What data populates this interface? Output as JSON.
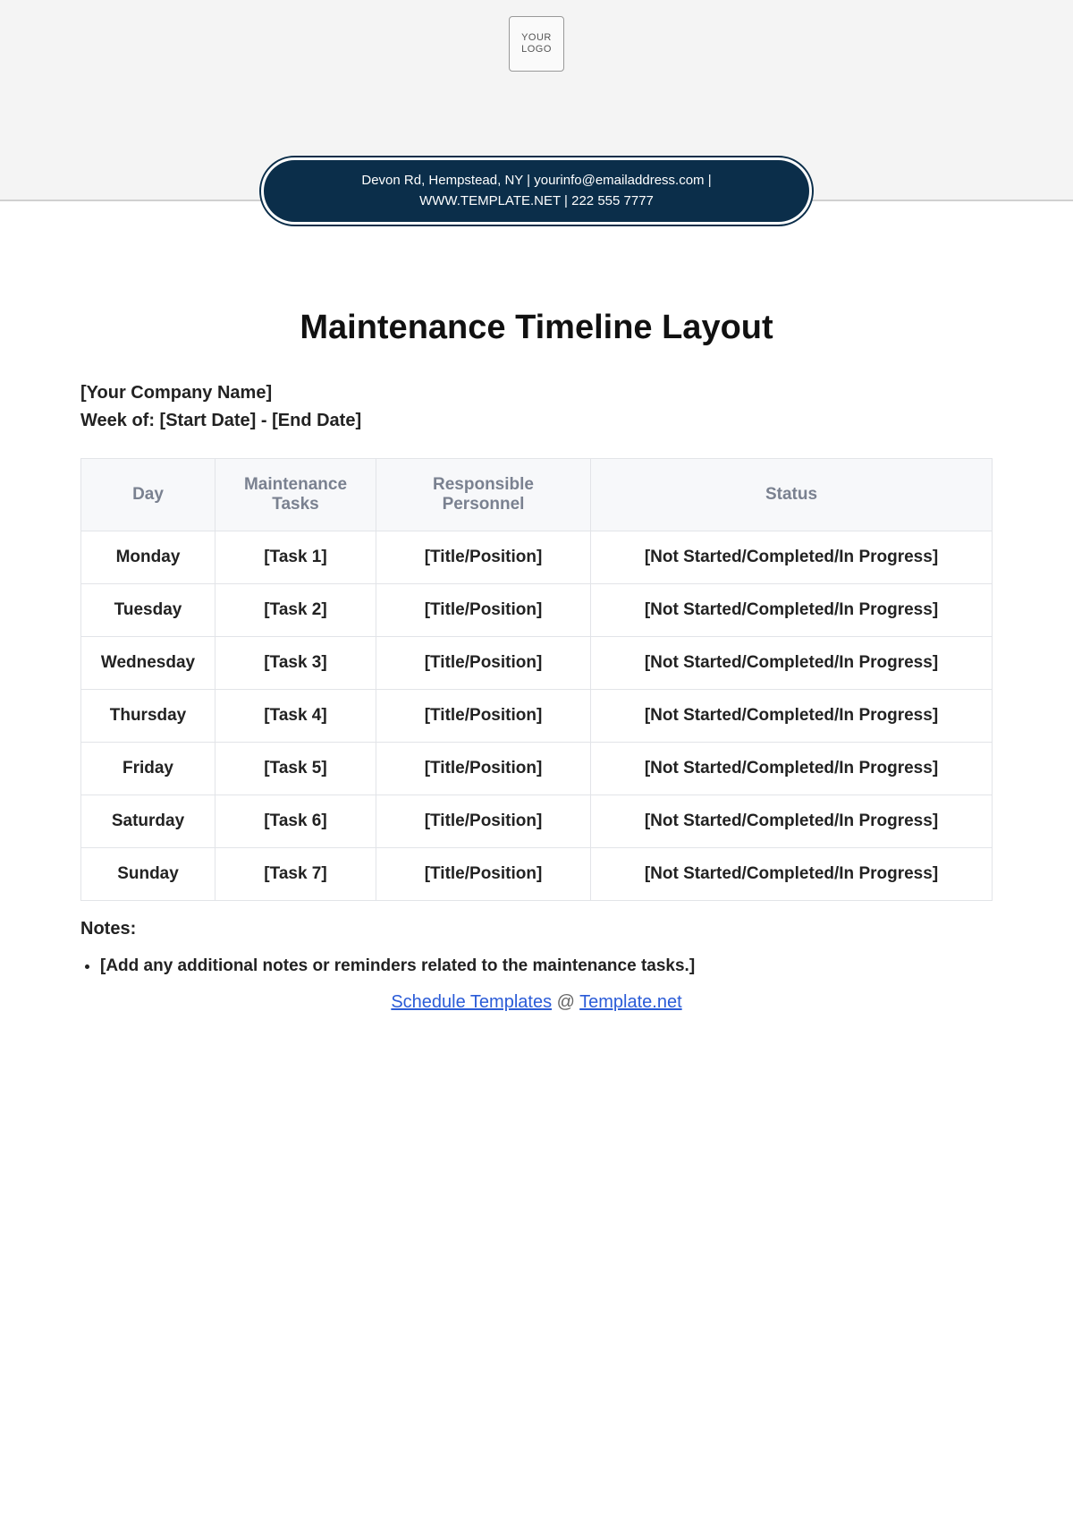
{
  "header": {
    "logo_text": "YOUR\nLOGO",
    "contact_line1": "Devon Rd, Hempstead, NY | yourinfo@emailaddress.com |",
    "contact_line2": "WWW.TEMPLATE.NET | 222 555 7777"
  },
  "title": "Maintenance Timeline Layout",
  "company_line": "[Your Company Name]",
  "week_line": "Week of: [Start Date] - [End Date]",
  "table": {
    "headers": {
      "day": "Day",
      "tasks": "Maintenance Tasks",
      "personnel": "Responsible Personnel",
      "status": "Status"
    },
    "rows": [
      {
        "day": "Monday",
        "task": "[Task 1]",
        "person": "[Title/Position]",
        "status": "[Not Started/Completed/In Progress]"
      },
      {
        "day": "Tuesday",
        "task": "[Task 2]",
        "person": "[Title/Position]",
        "status": "[Not Started/Completed/In Progress]"
      },
      {
        "day": "Wednesday",
        "task": "[Task 3]",
        "person": "[Title/Position]",
        "status": "[Not Started/Completed/In Progress]"
      },
      {
        "day": "Thursday",
        "task": "[Task 4]",
        "person": "[Title/Position]",
        "status": "[Not Started/Completed/In Progress]"
      },
      {
        "day": "Friday",
        "task": "[Task 5]",
        "person": "[Title/Position]",
        "status": "[Not Started/Completed/In Progress]"
      },
      {
        "day": "Saturday",
        "task": "[Task 6]",
        "person": "[Title/Position]",
        "status": "[Not Started/Completed/In Progress]"
      },
      {
        "day": "Sunday",
        "task": "[Task 7]",
        "person": "[Title/Position]",
        "status": "[Not Started/Completed/In Progress]"
      }
    ]
  },
  "notes": {
    "label": "Notes:",
    "items": [
      "[Add any additional notes or reminders related to the maintenance tasks.]"
    ]
  },
  "footer": {
    "link1_text": "Schedule Templates",
    "at": " @ ",
    "link2_text": "Template.net"
  }
}
